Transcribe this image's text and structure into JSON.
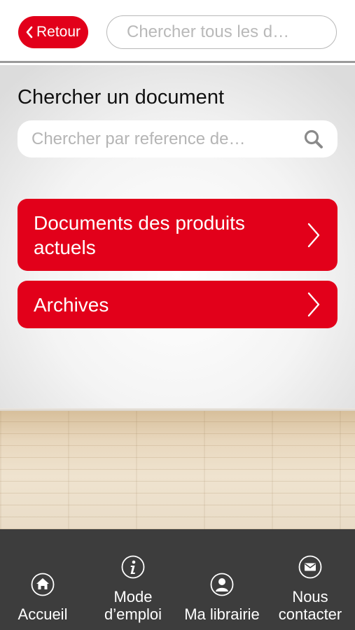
{
  "header": {
    "back_label": "Retour",
    "search_placeholder": "Chercher tous les d…"
  },
  "main": {
    "title": "Chercher un document",
    "search_placeholder": "Chercher par reference de…",
    "buttons": [
      {
        "label_line1": "Documents des produits",
        "label_line2": "actuels"
      },
      {
        "label": "Archives"
      }
    ]
  },
  "tabbar": {
    "items": [
      {
        "label": "Accueil",
        "icon": "home-icon"
      },
      {
        "label_line1": "Mode",
        "label_line2": "d’emploi",
        "icon": "info-icon"
      },
      {
        "label": "Ma librairie",
        "icon": "user-icon"
      },
      {
        "label_line1": "Nous",
        "label_line2": "contacter",
        "icon": "mail-icon"
      }
    ]
  },
  "colors": {
    "brand_red": "#e2001a",
    "tabbar_bg": "#3d3d3d"
  }
}
